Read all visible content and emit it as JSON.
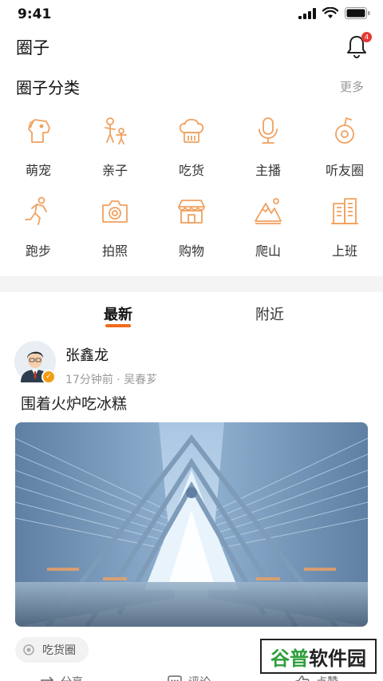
{
  "status_bar": {
    "time": "9:41"
  },
  "header": {
    "title": "圈子",
    "notification_count": "4"
  },
  "categories_section": {
    "title": "圈子分类",
    "more": "更多",
    "items": [
      {
        "label": "萌宠",
        "icon": "pet-dog-icon"
      },
      {
        "label": "亲子",
        "icon": "parent-child-icon"
      },
      {
        "label": "吃货",
        "icon": "chef-hat-icon"
      },
      {
        "label": "主播",
        "icon": "microphone-icon"
      },
      {
        "label": "听友圈",
        "icon": "music-note-icon"
      },
      {
        "label": "跑步",
        "icon": "running-icon"
      },
      {
        "label": "拍照",
        "icon": "camera-icon"
      },
      {
        "label": "购物",
        "icon": "shop-icon"
      },
      {
        "label": "爬山",
        "icon": "mountain-icon"
      },
      {
        "label": "上班",
        "icon": "office-building-icon"
      }
    ]
  },
  "feed_tabs": {
    "latest": "最新",
    "nearby": "附近",
    "active": "最新"
  },
  "post": {
    "author": "张鑫龙",
    "meta": "17分钟前 · 吴春芗",
    "text": "围着火炉吃冰糕",
    "tag": "吃货圈",
    "actions": {
      "share": "分享",
      "comment": "评论",
      "like": "点赞"
    }
  },
  "watermark": {
    "green": "谷普",
    "dark": "软件园"
  },
  "colors": {
    "accent": "#ef6c1a",
    "icon_stroke": "#f0a15f",
    "badge": "#e53935"
  }
}
